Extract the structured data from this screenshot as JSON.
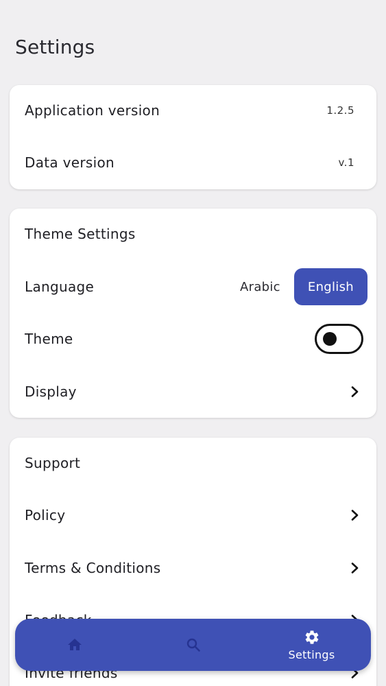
{
  "page": {
    "title": "Settings"
  },
  "about": {
    "app_version_label": "Application version",
    "app_version_value": "1.2.5",
    "data_version_label": "Data version",
    "data_version_value": "v.1"
  },
  "theme_settings": {
    "header": "Theme Settings",
    "language_label": "Language",
    "language_options": [
      "Arabic",
      "English"
    ],
    "language_selected": "English",
    "theme_label": "Theme",
    "theme_toggle_on": false,
    "display_label": "Display"
  },
  "support": {
    "header": "Support",
    "items": [
      {
        "label": "Policy"
      },
      {
        "label": "Terms & Conditions"
      },
      {
        "label": "Feedback"
      },
      {
        "label": "Invite friends"
      }
    ]
  },
  "bottom_nav": {
    "items": [
      {
        "icon": "home-icon",
        "label": ""
      },
      {
        "icon": "search-icon",
        "label": ""
      },
      {
        "icon": "gear-icon",
        "label": "Settings"
      }
    ],
    "active_index": 2
  },
  "colors": {
    "accent": "#3f51b5",
    "background": "#f0eff1",
    "card": "#ffffff",
    "inactive_nav_icon": "#263391"
  }
}
